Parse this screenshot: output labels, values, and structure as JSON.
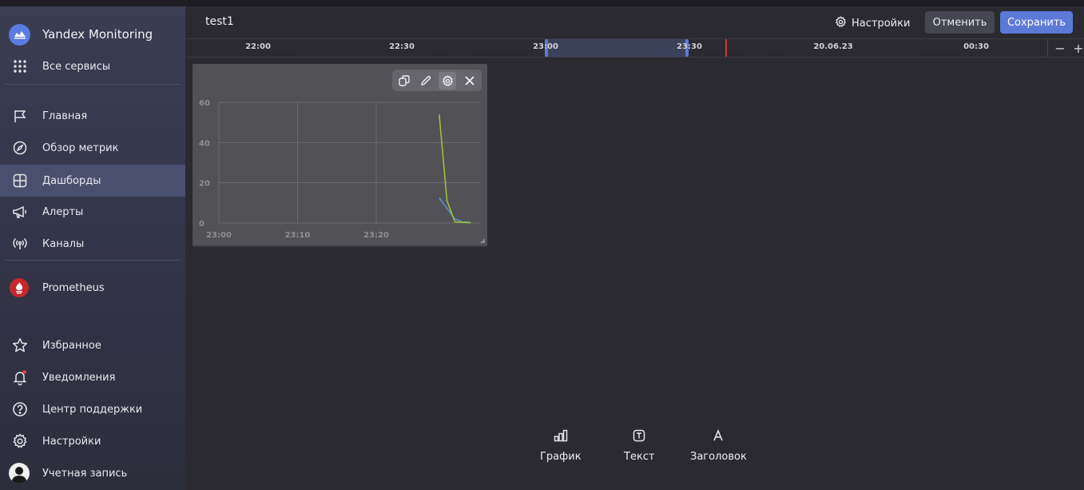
{
  "sidebar": {
    "brand": "Yandex Monitoring",
    "all_services": "Все сервисы",
    "nav": [
      {
        "label": "Главная",
        "icon": "flag-icon"
      },
      {
        "label": "Обзор метрик",
        "icon": "compass-icon"
      },
      {
        "label": "Дашборды",
        "icon": "dashboard-icon",
        "active": true
      },
      {
        "label": "Алерты",
        "icon": "megaphone-icon"
      },
      {
        "label": "Каналы",
        "icon": "broadcast-icon"
      }
    ],
    "prometheus": "Prometheus",
    "bottom": [
      {
        "label": "Избранное",
        "icon": "star-icon"
      },
      {
        "label": "Уведомления",
        "icon": "bell-icon"
      },
      {
        "label": "Центр поддержки",
        "icon": "help-icon"
      },
      {
        "label": "Настройки",
        "icon": "gear-icon"
      },
      {
        "label": "Учетная запись",
        "icon": "avatar"
      }
    ]
  },
  "header": {
    "title": "test1",
    "settings_label": "Настройки",
    "cancel_label": "Отменить",
    "save_label": "Сохранить"
  },
  "timeline": {
    "labels": [
      "22:00",
      "22:30",
      "23:00",
      "23:30",
      "20.06.23",
      "00:30"
    ],
    "zoom_out": "−",
    "zoom_in": "+"
  },
  "widget": {
    "toolbar": [
      "copy-icon",
      "pencil-icon",
      "gear-icon",
      "close-icon"
    ]
  },
  "chart_data": {
    "type": "line",
    "title": "",
    "xlabel": "",
    "ylabel": "",
    "x_ticks": [
      "23:00",
      "23:10",
      "23:20"
    ],
    "y_ticks": [
      "0",
      "20",
      "40",
      "60"
    ],
    "ylim": [
      0,
      60
    ],
    "grid": true,
    "series": [
      {
        "color": "#5b8fc9",
        "x": [
          "23:28",
          "23:30",
          "23:31",
          "23:32"
        ],
        "values": [
          12.5,
          2,
          0.5,
          0.3
        ]
      },
      {
        "color": "#9cbf3a",
        "x": [
          "23:28",
          "23:29",
          "23:30",
          "23:32"
        ],
        "values": [
          54,
          11,
          0.5,
          0.2
        ]
      }
    ]
  },
  "add_bar": {
    "chart": "График",
    "text": "Текст",
    "heading": "Заголовок"
  }
}
